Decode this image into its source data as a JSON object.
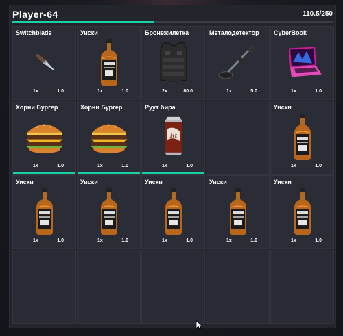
{
  "player": {
    "name": "Player-64",
    "weight": "110.5/250",
    "weight_fraction": 0.442
  },
  "slots": [
    {
      "label": "Switchblade",
      "qty": "1x",
      "weight": "1.0",
      "icon": "knife-icon",
      "durability": 0
    },
    {
      "label": "Уиски",
      "qty": "1x",
      "weight": "1.0",
      "icon": "whiskey-bottle-icon",
      "durability": 0
    },
    {
      "label": "Бронежилетка",
      "qty": "2x",
      "weight": "80.0",
      "icon": "body-armor-icon",
      "durability": 0
    },
    {
      "label": "Металодетектор",
      "qty": "1x",
      "weight": "5.0",
      "icon": "metal-detector-icon",
      "durability": 0
    },
    {
      "label": "CyberBook",
      "qty": "1x",
      "weight": "1.0",
      "icon": "laptop-icon",
      "durability": 0
    },
    {
      "label": "Хорни Бургер",
      "qty": "1x",
      "weight": "1.0",
      "icon": "burger-icon",
      "durability": 1
    },
    {
      "label": "Хорни Бургер",
      "qty": "1x",
      "weight": "1.0",
      "icon": "burger-icon",
      "durability": 1
    },
    {
      "label": "Руут бира",
      "qty": "1x",
      "weight": "1.0",
      "icon": "soda-can-icon",
      "durability": 1
    },
    {
      "label": "",
      "qty": "",
      "weight": "",
      "icon": "",
      "durability": 0
    },
    {
      "label": "Уиски",
      "qty": "1x",
      "weight": "1.0",
      "icon": "whiskey-bottle-icon",
      "durability": 0
    },
    {
      "label": "Уиски",
      "qty": "1x",
      "weight": "1.0",
      "icon": "whiskey-bottle-icon",
      "durability": 0
    },
    {
      "label": "Уиски",
      "qty": "1x",
      "weight": "1.0",
      "icon": "whiskey-bottle-icon",
      "durability": 0
    },
    {
      "label": "Уиски",
      "qty": "1x",
      "weight": "1.0",
      "icon": "whiskey-bottle-icon",
      "durability": 0
    },
    {
      "label": "Уиски",
      "qty": "1x",
      "weight": "1.0",
      "icon": "whiskey-bottle-icon",
      "durability": 0
    },
    {
      "label": "Уиски",
      "qty": "1x",
      "weight": "1.0",
      "icon": "whiskey-bottle-icon",
      "durability": 0
    },
    {
      "label": "",
      "qty": "",
      "weight": "",
      "icon": "",
      "durability": 0
    },
    {
      "label": "",
      "qty": "",
      "weight": "",
      "icon": "",
      "durability": 0
    },
    {
      "label": "",
      "qty": "",
      "weight": "",
      "icon": "",
      "durability": 0
    },
    {
      "label": "",
      "qty": "",
      "weight": "",
      "icon": "",
      "durability": 0
    },
    {
      "label": "",
      "qty": "",
      "weight": "",
      "icon": "",
      "durability": 0
    }
  ],
  "colors": {
    "accent": "#19d1a7",
    "panel": "#23252d",
    "slot": "#2b2d36"
  }
}
